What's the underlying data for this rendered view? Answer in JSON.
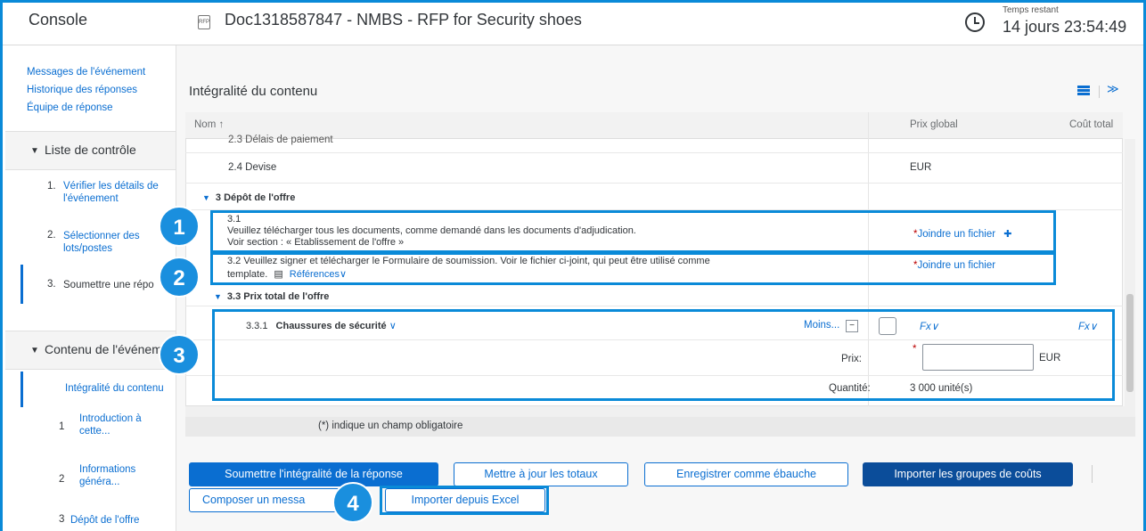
{
  "header": {
    "app_title": "Console",
    "doc_icon": "rfp-doc-icon",
    "doc_title": "Doc1318587847 - NMBS - RFP for Security shoes",
    "time_label": "Temps restant",
    "time_value": "14 jours 23:54:49"
  },
  "sidebar": {
    "links": [
      "Messages de l'événement",
      "Historique des réponses",
      "Équipe de réponse"
    ],
    "checklist_title": "Liste de contrôle",
    "checklist": [
      {
        "num": "1.",
        "line1": "Vérifier les détails de",
        "line2": "l'événement"
      },
      {
        "num": "2.",
        "line1": "Sélectionner des",
        "line2": "lots/postes"
      },
      {
        "num": "3.",
        "line1": "Soumettre une répo",
        "line2": ""
      }
    ],
    "content_title": "Contenu de l'événem",
    "content_items": [
      {
        "num": "",
        "line1": "Intégralité du contenu",
        "line2": ""
      },
      {
        "num": "1",
        "line1": "Introduction à",
        "line2": "cette..."
      },
      {
        "num": "2",
        "line1": "Informations",
        "line2": "généra..."
      },
      {
        "num": "3",
        "line1": "Dépôt de l'offre",
        "line2": ""
      }
    ]
  },
  "main": {
    "title": "Intégralité du contenu",
    "columns": {
      "name": "Nom ↑",
      "price": "Prix global",
      "cost": "Coût total"
    },
    "rows": {
      "r23": "2.3  Délais de paiement",
      "r24": "2.4  Devise",
      "r24_value": "EUR",
      "sec3": "3  Dépôt de l'offre",
      "r31_num": "3.1",
      "r31_line1": "Veuillez télécharger tous les documents, comme demandé dans les documents d'adjudication.",
      "r31_line2": "Voir section : « Etablissement de l'offre »",
      "r31_action": "Joindre un fichier",
      "r32_line1": "3.2  Veuillez signer et télécharger le Formulaire de soumission. Voir le fichier ci-joint, qui peut être utilisé comme",
      "r32_line2": "template.",
      "r32_ref": "Références",
      "r32_action": "Joindre un fichier",
      "sec33": "3.3  Prix total de l'offre",
      "r331_num": "3.3.1",
      "r331_title": "Chaussures de sécurité",
      "r331_less": "Moins...",
      "fx": "Fx",
      "price_label": "Prix:",
      "price_currency": "EUR",
      "qty_label": "Quantité:",
      "qty_value": "3 000 unité(s)"
    },
    "note": "(*) indique un champ obligatoire"
  },
  "buttons": {
    "submit": "Soumettre l'intégralité de la réponse",
    "update": "Mettre à jour les totaux",
    "draft": "Enregistrer comme ébauche",
    "import_groups": "Importer les groupes de coûts",
    "compose": "Composer un messa",
    "import_excel": "Importer depuis Excel"
  },
  "badges": [
    "1",
    "2",
    "3",
    "4"
  ],
  "colors": {
    "accent": "#0a6ed1",
    "highlight": "#0a8ad8",
    "badge": "#1a8fde",
    "required": "#bb0000"
  }
}
